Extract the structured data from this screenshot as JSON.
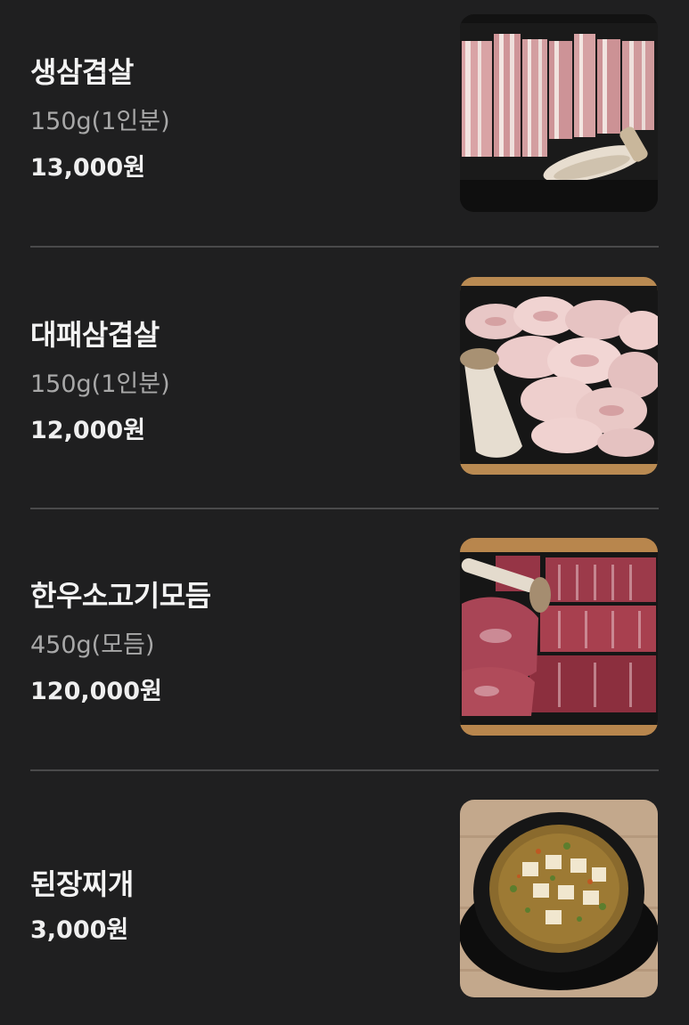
{
  "menu": {
    "items": [
      {
        "name": "생삼겹살",
        "description": "150g(1인분)",
        "price": "13,000원"
      },
      {
        "name": "대패삼겹살",
        "description": "150g(1인분)",
        "price": "12,000원"
      },
      {
        "name": "한우소고기모듬",
        "description": "450g(모듬)",
        "price": "120,000원"
      },
      {
        "name": "된장찌개",
        "price": "3,000원"
      }
    ]
  },
  "colors": {
    "background": "#1f1f20",
    "divider": "#4a4a4b",
    "title": "#f3f3f3",
    "description": "#a8a8a8",
    "price": "#efefef"
  },
  "images": [
    "pork-belly-photo",
    "thin-sliced-pork-photo",
    "korean-beef-platter-photo",
    "soybean-paste-stew-photo"
  ]
}
